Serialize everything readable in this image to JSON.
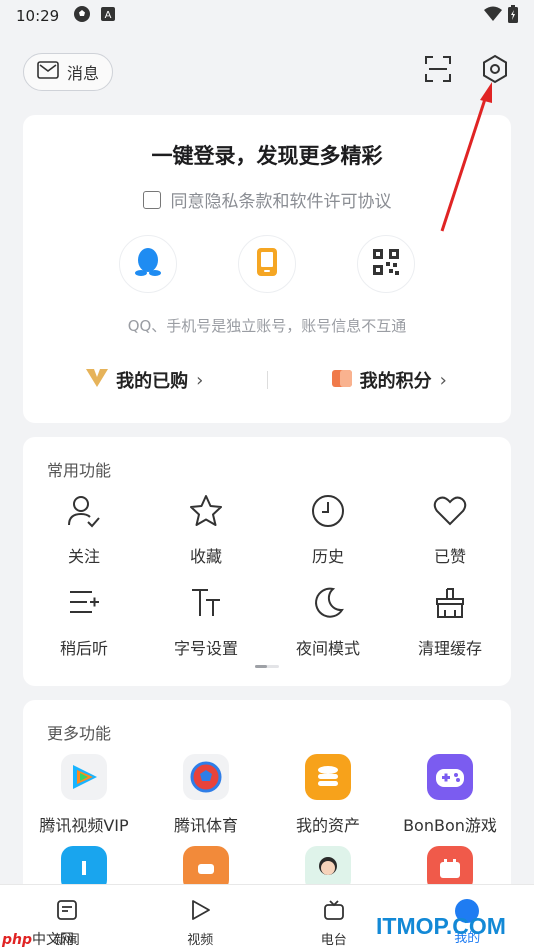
{
  "status_bar": {
    "time": "10:29"
  },
  "header": {
    "message_label": "消息"
  },
  "login_card": {
    "title": "一键登录，发现更多精彩",
    "agreement": "同意隐私条款和软件许可协议",
    "methods": [
      "qq-icon",
      "phone-icon",
      "qrcode-icon"
    ],
    "note": "QQ、手机号是独立账号，账号信息不互通",
    "purchased_label": "我的已购",
    "points_label": "我的积分"
  },
  "common_functions": {
    "title": "常用功能",
    "items": [
      {
        "label": "关注",
        "icon": "follow-icon"
      },
      {
        "label": "收藏",
        "icon": "star-icon"
      },
      {
        "label": "历史",
        "icon": "clock-icon"
      },
      {
        "label": "已赞",
        "icon": "heart-icon"
      },
      {
        "label": "稍后听",
        "icon": "listen-later-icon"
      },
      {
        "label": "字号设置",
        "icon": "font-size-icon"
      },
      {
        "label": "夜间模式",
        "icon": "moon-icon"
      },
      {
        "label": "清理缓存",
        "icon": "broom-icon"
      }
    ]
  },
  "more_functions": {
    "title": "更多功能",
    "items": [
      {
        "label": "腾讯视频VIP",
        "icon": "tencent-video-icon"
      },
      {
        "label": "腾讯体育",
        "icon": "tencent-sports-icon"
      },
      {
        "label": "我的资产",
        "icon": "assets-icon"
      },
      {
        "label": "BonBon游戏",
        "icon": "game-icon"
      }
    ]
  },
  "tabbar": {
    "tabs": [
      {
        "label": "新闻"
      },
      {
        "label": "视频"
      },
      {
        "label": "电台"
      },
      {
        "label": "我的"
      }
    ]
  },
  "watermarks": {
    "left": "中文网",
    "left_brand": "php",
    "right": "ITMOP.COM"
  },
  "colors": {
    "accent": "#1f7cf2",
    "arrow": "#e02424"
  }
}
